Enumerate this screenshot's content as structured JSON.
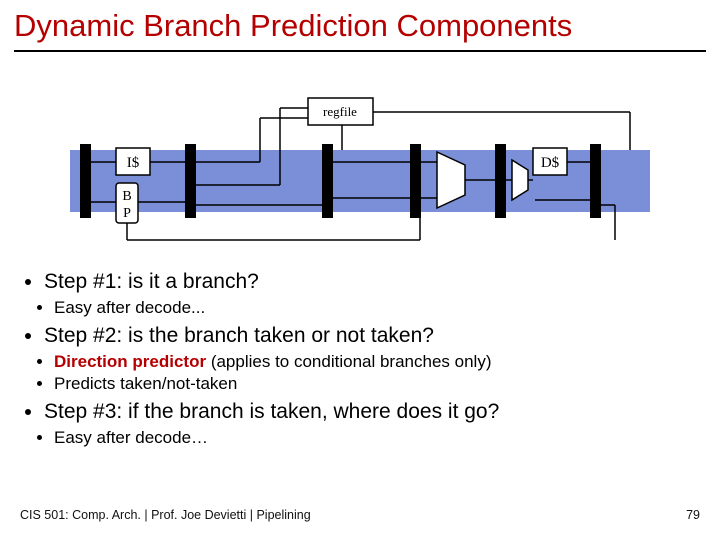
{
  "title": "Dynamic Branch Prediction Components",
  "diagram": {
    "regfile": "regfile",
    "icache": "I$",
    "bp1": "B",
    "bp2": "P",
    "dcache": "D$"
  },
  "bullets": {
    "s1": "Step #1: is it a branch?",
    "s1a": "Easy after decode...",
    "s2": "Step #2: is the branch taken or not taken?",
    "s2a_emph": "Direction predictor",
    "s2a_rest": " (applies to conditional branches only)",
    "s2b": "Predicts taken/not-taken",
    "s3": "Step #3: if the branch is taken, where does it go?",
    "s3a": "Easy after decode…"
  },
  "footer": {
    "left": "CIS 501: Comp. Arch.  |  Prof. Joe Devietti  |  Pipelining",
    "right": "79"
  }
}
